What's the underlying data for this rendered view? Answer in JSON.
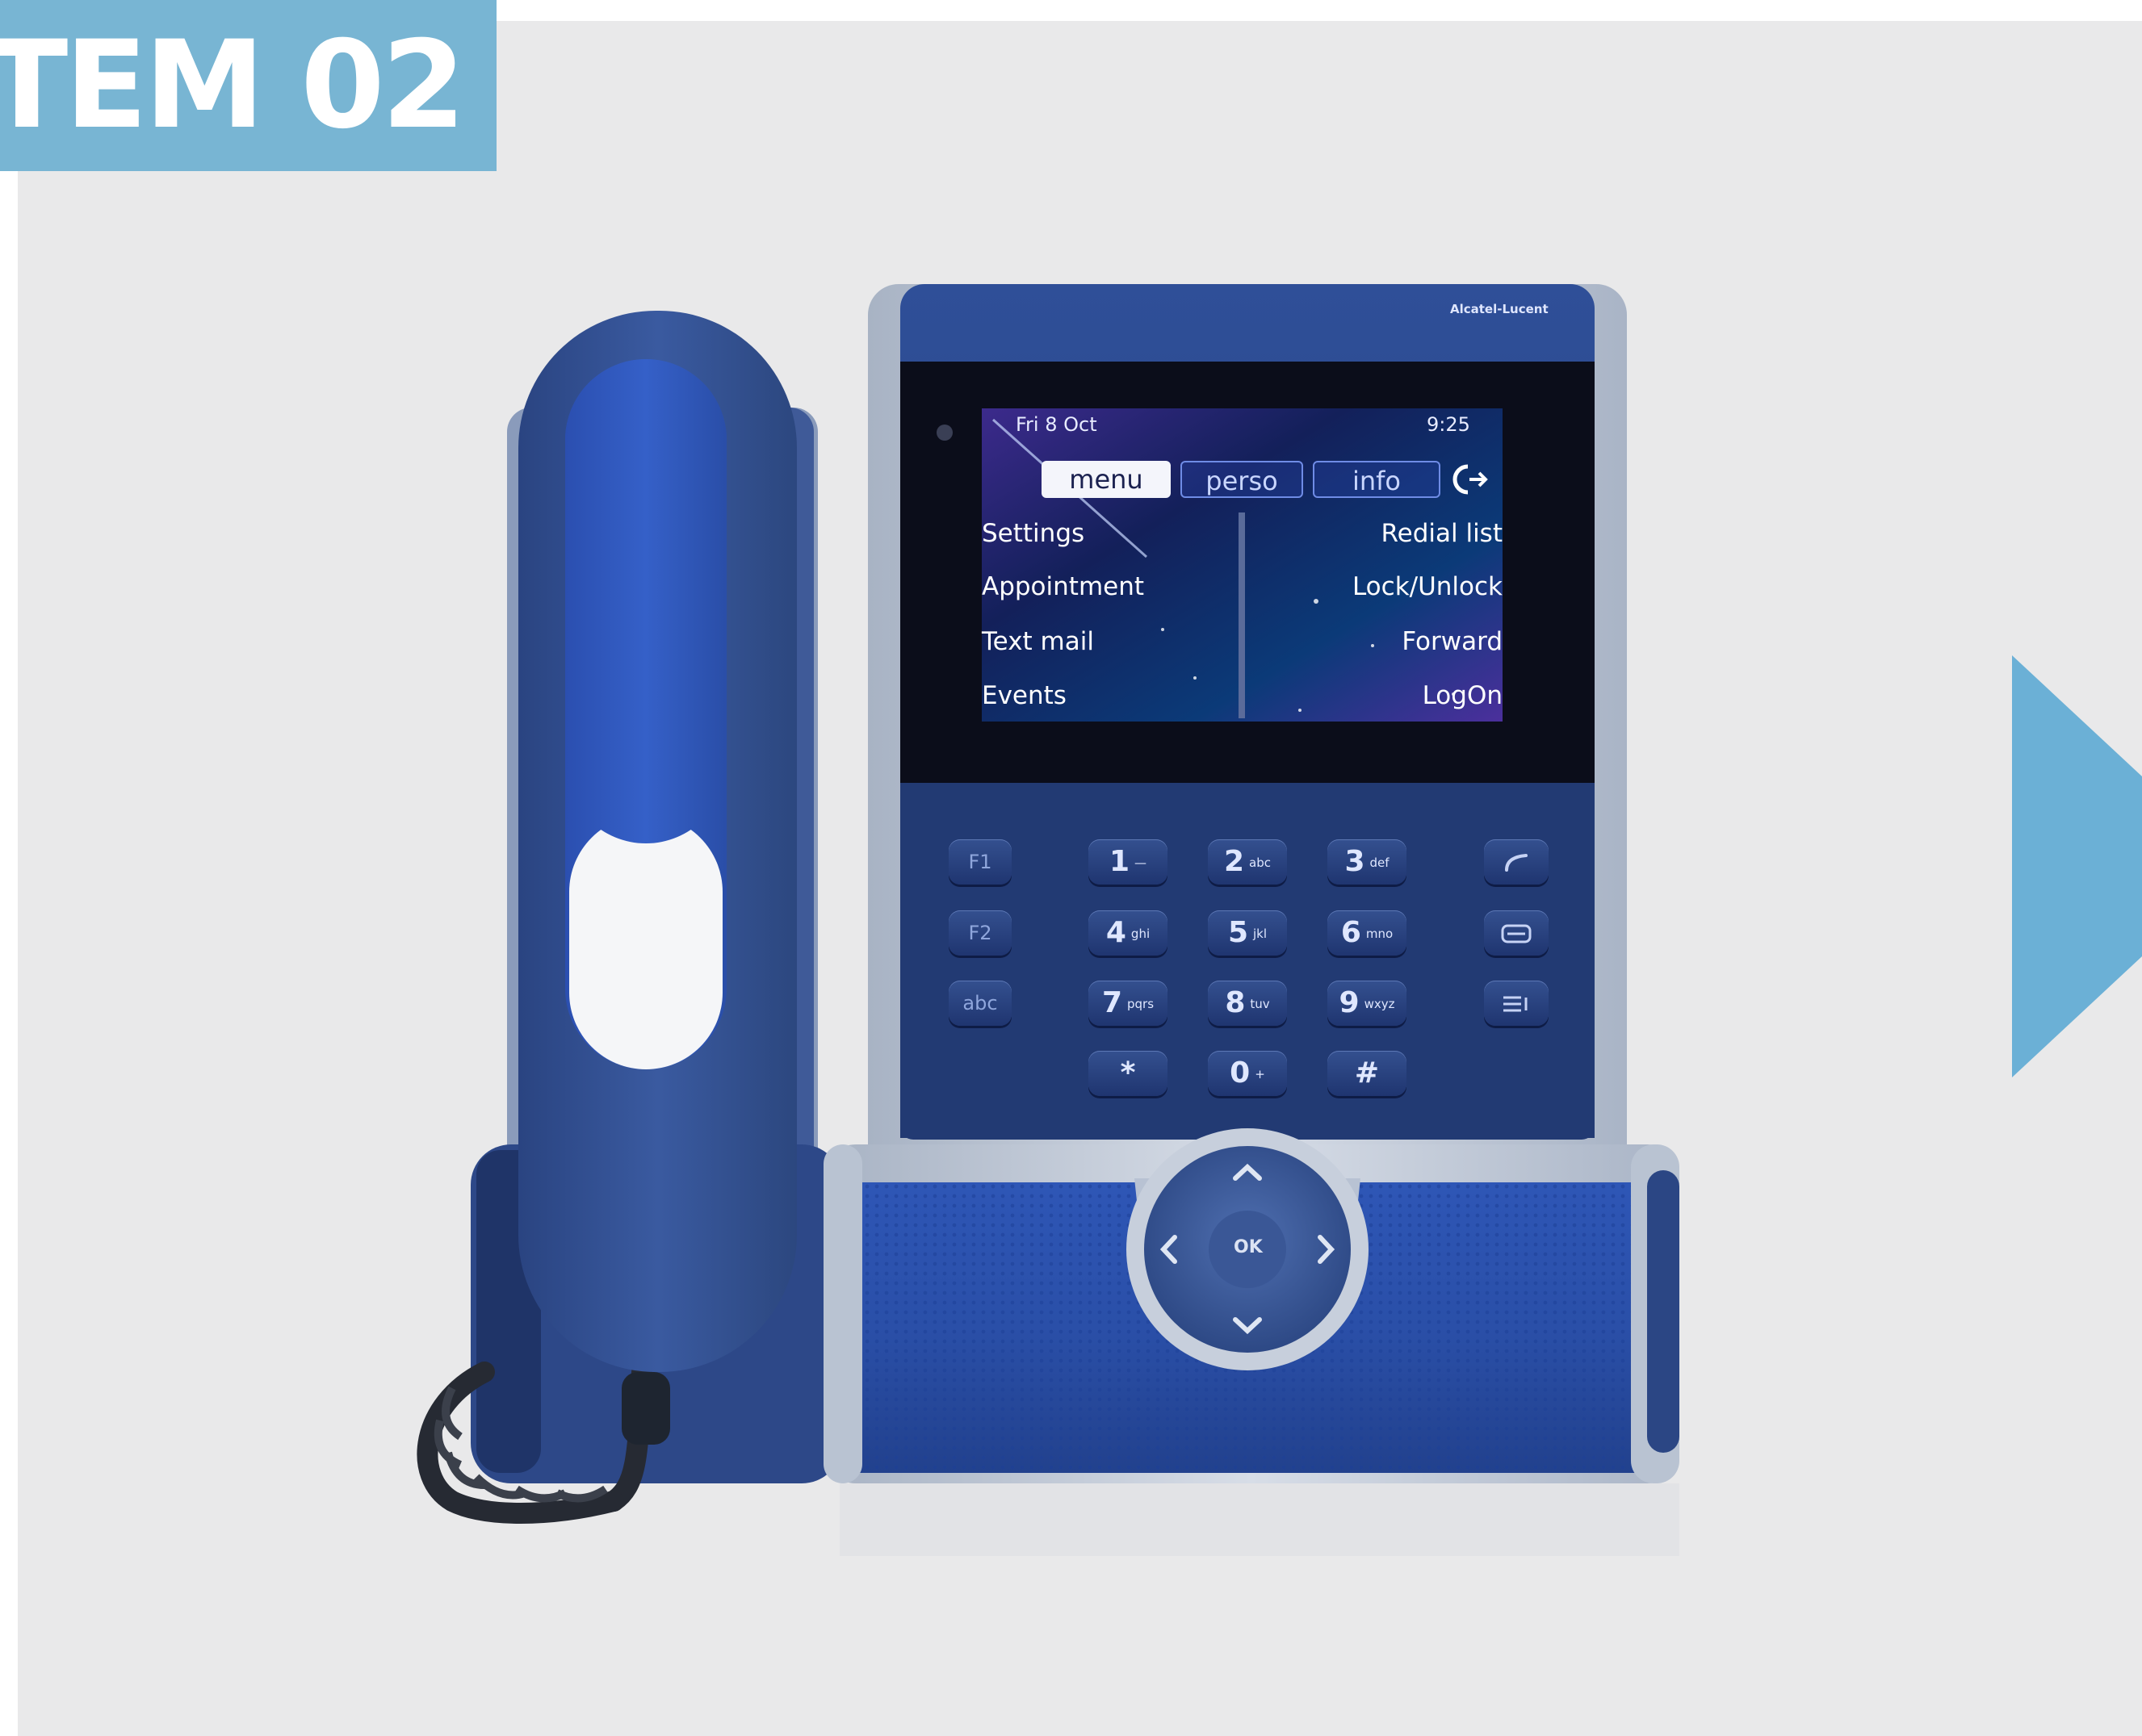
{
  "item_tag": "TEM 02",
  "brand": "Alcatel-Lucent",
  "screen": {
    "date": "Fri 8 Oct",
    "time": "9:25",
    "tabs": [
      "menu",
      "perso",
      "info"
    ],
    "left_items": [
      "Settings",
      "Appointment",
      "Text mail",
      "Events"
    ],
    "right_items": [
      "Redial list",
      "Lock/Unlock",
      "Forward",
      "LogOn"
    ]
  },
  "keys": {
    "f1": "F1",
    "f2": "F2",
    "abc": "abc",
    "k1": "1",
    "k1s": "—",
    "k2": "2",
    "k2s": "abc",
    "k3": "3",
    "k3s": "def",
    "k4": "4",
    "k4s": "ghi",
    "k5": "5",
    "k5s": "jkl",
    "k6": "6",
    "k6s": "mno",
    "k7": "7",
    "k7s": "pqrs",
    "k8": "8",
    "k8s": "tuv",
    "k9": "9",
    "k9s": "wxyz",
    "star": "*",
    "k0": "0",
    "k0s": "+",
    "hash": "#"
  },
  "navigator_ok": "OK",
  "colors": {
    "background": "#e9e9ea",
    "tag": "#78b5d3",
    "phone_blue": "#2f4d93",
    "speaker_blue": "#2a52b0",
    "silver": "#b9c3d2"
  }
}
